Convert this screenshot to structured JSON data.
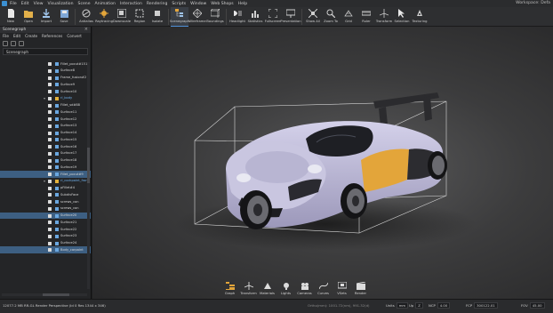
{
  "menu": {
    "items": [
      "File",
      "Edit",
      "View",
      "Visualization",
      "Scene",
      "Animation",
      "Interaction",
      "Rendering",
      "Scripts",
      "Window",
      "Web Shops",
      "Help"
    ],
    "workspace": "Workspace: Defa"
  },
  "toolbar": {
    "buttons": [
      {
        "label": "New",
        "icon": "new-file-icon"
      },
      {
        "label": "Open",
        "icon": "open-folder-icon"
      },
      {
        "label": "Import",
        "icon": "import-icon"
      },
      {
        "label": "Save",
        "icon": "save-icon"
      },
      {
        "label": "Antialias",
        "icon": "antialias-icon"
      },
      {
        "label": "Raytracing",
        "icon": "raytracing-icon"
      },
      {
        "label": "Downscale",
        "icon": "downscale-icon"
      },
      {
        "label": "Region",
        "icon": "region-icon"
      },
      {
        "label": "Isolate",
        "icon": "isolate-icon"
      },
      {
        "label": "Scenegraph",
        "icon": "scenegraph-icon"
      },
      {
        "label": "Wireframe",
        "icon": "wireframe-icon"
      },
      {
        "label": "Boundings",
        "icon": "boundings-icon"
      },
      {
        "label": "Headlight",
        "icon": "headlight-icon"
      },
      {
        "label": "Statistics",
        "icon": "statistics-icon"
      },
      {
        "label": "Fullscreen",
        "icon": "fullscreen-icon"
      },
      {
        "label": "Presentation",
        "icon": "presentation-icon"
      },
      {
        "label": "Show All",
        "icon": "show-all-icon"
      },
      {
        "label": "Zoom To",
        "icon": "zoom-to-icon"
      },
      {
        "label": "Grid",
        "icon": "grid-icon"
      },
      {
        "label": "Ruler",
        "icon": "ruler-icon"
      },
      {
        "label": "Transform",
        "icon": "transform-icon"
      },
      {
        "label": "Selection",
        "icon": "selection-icon"
      },
      {
        "label": "Texturing",
        "icon": "texturing-icon"
      }
    ]
  },
  "scenegraph": {
    "title": "Scenegraph",
    "menu": [
      "File",
      "Edit",
      "Create",
      "References",
      "Convert"
    ],
    "search_value": "Scenegraph",
    "nodes": [
      {
        "label": "Fillet_pocut#151",
        "kind": "leaf",
        "selected": false
      },
      {
        "label": "Surface8",
        "kind": "leaf",
        "selected": false
      },
      {
        "label": "Frame_fusion#2",
        "kind": "leaf",
        "selected": false
      },
      {
        "label": "Surface9",
        "kind": "leaf",
        "selected": false
      },
      {
        "label": "Surface10",
        "kind": "leaf",
        "selected": false
      },
      {
        "label": "rl_body",
        "kind": "group",
        "selected": false
      },
      {
        "label": "Fillet_sd#88",
        "kind": "leaf",
        "selected": false
      },
      {
        "label": "Surface11",
        "kind": "leaf",
        "selected": false
      },
      {
        "label": "Surface12",
        "kind": "leaf",
        "selected": false
      },
      {
        "label": "Surface13",
        "kind": "leaf",
        "selected": false
      },
      {
        "label": "Surface14",
        "kind": "leaf",
        "selected": false
      },
      {
        "label": "Surface15",
        "kind": "leaf",
        "selected": false
      },
      {
        "label": "Surface16",
        "kind": "leaf",
        "selected": false
      },
      {
        "label": "Surface17",
        "kind": "leaf",
        "selected": false
      },
      {
        "label": "Surface18",
        "kind": "leaf",
        "selected": false
      },
      {
        "label": "Surface19",
        "kind": "leaf",
        "selected": false
      },
      {
        "label": "Fillet_pocut#9",
        "kind": "leaf",
        "selected": true
      },
      {
        "label": "rl_cockpaint_front",
        "kind": "group",
        "selected": false
      },
      {
        "label": "pFillet#4",
        "kind": "leaf",
        "selected": false
      },
      {
        "label": "SubdivFace",
        "kind": "leaf",
        "selected": false
      },
      {
        "label": "screws_con",
        "kind": "leaf",
        "selected": false
      },
      {
        "label": "screws_con",
        "kind": "leaf",
        "selected": false
      },
      {
        "label": "Surface20",
        "kind": "leaf",
        "selected": true
      },
      {
        "label": "Surface21",
        "kind": "leaf",
        "selected": false
      },
      {
        "label": "Surface22",
        "kind": "leaf",
        "selected": false
      },
      {
        "label": "Surface23",
        "kind": "leaf",
        "selected": false
      },
      {
        "label": "Surface24",
        "kind": "leaf",
        "selected": false
      },
      {
        "label": "Body_carpaint",
        "kind": "leaf",
        "selected": true
      }
    ]
  },
  "dock": {
    "buttons": [
      {
        "label": "Graph",
        "icon": "graph-icon",
        "active": true
      },
      {
        "label": "Transform",
        "icon": "transform-dock-icon",
        "active": false
      },
      {
        "label": "Materials",
        "icon": "materials-icon",
        "active": false
      },
      {
        "label": "Lights",
        "icon": "lights-icon",
        "active": false
      },
      {
        "label": "Cameras",
        "icon": "cameras-icon",
        "active": false
      },
      {
        "label": "Curves",
        "icon": "curves-icon",
        "active": false
      },
      {
        "label": "VSets",
        "icon": "vsets-icon",
        "active": false
      },
      {
        "label": "Render",
        "icon": "render-icon",
        "active": false
      }
    ]
  },
  "status": {
    "message": "12077.2 MB  RR-GL  Render Perspective (Id 0 Res 1344 x 346)",
    "coordinates": "Ortho(mm): 1001.72(nm), 991.32(d)",
    "units_label": "Units",
    "units_value": "mm",
    "up_label": "Up",
    "up_value": "Z",
    "ncp_label": "NCP",
    "ncp_value": "4.00",
    "fcp_label": "FCP",
    "fcp_value": "300122.01",
    "fov_label": "FOV",
    "fov_value": "45.00"
  },
  "colors": {
    "accent": "#4f8fd6",
    "selection": "#3d5f82",
    "car_body": "#b7b3d3",
    "car_accent": "#e3a53a",
    "bounding_box": "#d9d9d9"
  }
}
